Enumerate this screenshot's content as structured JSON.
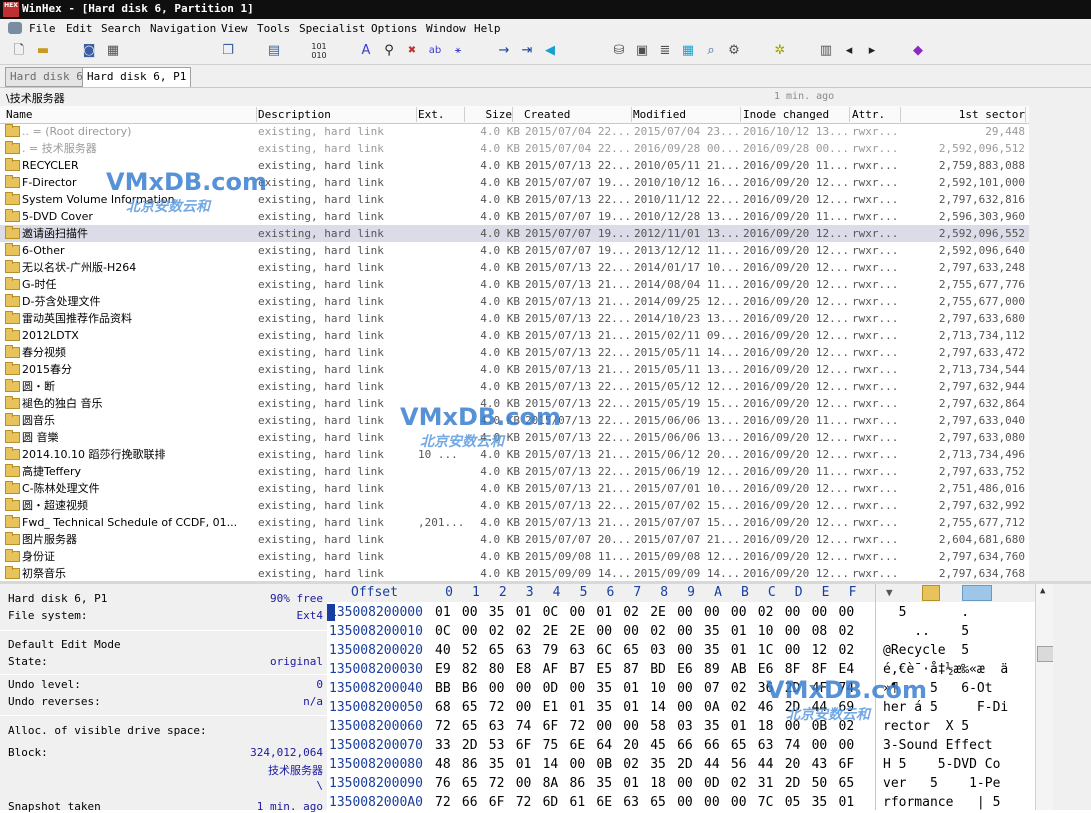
{
  "window": {
    "title": "WinHex - [Hard disk 6, Partition 1]",
    "app_icon_text": "HEX"
  },
  "menu": [
    "File",
    "Edit",
    "Search",
    "Navigation",
    "View",
    "Tools",
    "Specialist",
    "Options",
    "Window",
    "Help"
  ],
  "toolbar": {
    "icons": [
      "new-file-icon",
      "open-file-icon",
      "save-icon",
      "print-icon",
      "copy-icon",
      "paste-icon",
      "hex-edit-icon",
      "find-icon",
      "find-hex-icon",
      "replace-icon",
      "replace-hex-icon",
      "goto-icon",
      "goto-offset-icon",
      "back-icon",
      "disk-icon",
      "drive-icon",
      "ram-icon",
      "calculator-icon",
      "magnify-icon",
      "settings-icon",
      "gear-icon",
      "view-icon",
      "prev-icon",
      "next-icon",
      "case-icon"
    ]
  },
  "tabs": [
    {
      "label": "Hard disk 6",
      "active": false
    },
    {
      "label": "Hard disk 6, P1",
      "active": true
    }
  ],
  "path": {
    "current": "\\技术服务器",
    "updated": "1 min. ago"
  },
  "columns": [
    "Name",
    "Description",
    "Ext.",
    "Size",
    "Created",
    "Modified",
    "Inode changed",
    "Attr.",
    "1st sector"
  ],
  "rows": [
    {
      "name": "..  =  (Root directory)",
      "desc": "existing, hard link",
      "ext": "",
      "size": "4.0 KB",
      "created": "2015/07/04  22...",
      "modified": "2015/07/04  23...",
      "inode": "2016/10/12  13...",
      "attr": "rwxr...",
      "sector": "29,448",
      "dim": true
    },
    {
      "name": ".  =  技术服务器",
      "desc": "existing, hard link",
      "ext": "",
      "size": "4.0 KB",
      "created": "2015/07/04  22...",
      "modified": "2016/09/28  00...",
      "inode": "2016/09/28  00...",
      "attr": "rwxr...",
      "sector": "2,592,096,512",
      "dim": true
    },
    {
      "name": "RECYCLER",
      "desc": "existing, hard link",
      "ext": "",
      "size": "4.0 KB",
      "created": "2015/07/13  22...",
      "modified": "2010/05/11  21...",
      "inode": "2016/09/20  11...",
      "attr": "rwxr...",
      "sector": "2,759,883,088"
    },
    {
      "name": "F-Director",
      "desc": "existing, hard link",
      "ext": "",
      "size": "4.0 KB",
      "created": "2015/07/07  19...",
      "modified": "2010/10/12  16...",
      "inode": "2016/09/20  12...",
      "attr": "rwxr...",
      "sector": "2,592,101,000"
    },
    {
      "name": "System Volume Information",
      "desc": "existing, hard link",
      "ext": "",
      "size": "4.0 KB",
      "created": "2015/07/13  22...",
      "modified": "2010/11/12  22...",
      "inode": "2016/09/20  12...",
      "attr": "rwxr...",
      "sector": "2,797,632,816"
    },
    {
      "name": "5-DVD Cover",
      "desc": "existing, hard link",
      "ext": "",
      "size": "4.0 KB",
      "created": "2015/07/07  19...",
      "modified": "2010/12/28  13...",
      "inode": "2016/09/20  11...",
      "attr": "rwxr...",
      "sector": "2,596,303,960"
    },
    {
      "name": "邀请函扫描件",
      "desc": "existing, hard link",
      "ext": "",
      "size": "4.0 KB",
      "created": "2015/07/07  19...",
      "modified": "2012/11/01  13...",
      "inode": "2016/09/20  12...",
      "attr": "rwxr...",
      "sector": "2,592,096,552",
      "sel": true
    },
    {
      "name": "6-Other",
      "desc": "existing, hard link",
      "ext": "",
      "size": "4.0 KB",
      "created": "2015/07/07  19...",
      "modified": "2013/12/12  11...",
      "inode": "2016/09/20  12...",
      "attr": "rwxr...",
      "sector": "2,592,096,640"
    },
    {
      "name": "无以名状-广州版-H264",
      "desc": "existing, hard link",
      "ext": "",
      "size": "4.0 KB",
      "created": "2015/07/13  22...",
      "modified": "2014/01/17  10...",
      "inode": "2016/09/20  12...",
      "attr": "rwxr...",
      "sector": "2,797,633,248"
    },
    {
      "name": "G-时任",
      "desc": "existing, hard link",
      "ext": "",
      "size": "4.0 KB",
      "created": "2015/07/13  21...",
      "modified": "2014/08/04  11...",
      "inode": "2016/09/20  12...",
      "attr": "rwxr...",
      "sector": "2,755,677,776"
    },
    {
      "name": "D-芬含处理文件",
      "desc": "existing, hard link",
      "ext": "",
      "size": "4.0 KB",
      "created": "2015/07/13  21...",
      "modified": "2014/09/25  12...",
      "inode": "2016/09/20  12...",
      "attr": "rwxr...",
      "sector": "2,755,677,000"
    },
    {
      "name": "雷动英国推荐作品资料",
      "desc": "existing, hard link",
      "ext": "",
      "size": "4.0 KB",
      "created": "2015/07/13  22...",
      "modified": "2014/10/23  13...",
      "inode": "2016/09/20  12...",
      "attr": "rwxr...",
      "sector": "2,797,633,680"
    },
    {
      "name": "2012LDTX",
      "desc": "existing, hard link",
      "ext": "",
      "size": "4.0 KB",
      "created": "2015/07/13  21...",
      "modified": "2015/02/11  09...",
      "inode": "2016/09/20  12...",
      "attr": "rwxr...",
      "sector": "2,713,734,112"
    },
    {
      "name": "春分视频",
      "desc": "existing, hard link",
      "ext": "",
      "size": "4.0 KB",
      "created": "2015/07/13  22...",
      "modified": "2015/05/11  14...",
      "inode": "2016/09/20  12...",
      "attr": "rwxr...",
      "sector": "2,797,633,472"
    },
    {
      "name": "2015春分",
      "desc": "existing, hard link",
      "ext": "",
      "size": "4.0 KB",
      "created": "2015/07/13  21...",
      "modified": "2015/05/11  13...",
      "inode": "2016/09/20  12...",
      "attr": "rwxr...",
      "sector": "2,713,734,544"
    },
    {
      "name": "圆・断",
      "desc": "existing, hard link",
      "ext": "",
      "size": "4.0 KB",
      "created": "2015/07/13  22...",
      "modified": "2015/05/12  12...",
      "inode": "2016/09/20  12...",
      "attr": "rwxr...",
      "sector": "2,797,632,944"
    },
    {
      "name": "  褪色的独白  音乐",
      "desc": "existing, hard link",
      "ext": "",
      "size": "4.0 KB",
      "created": "2015/07/13  22...",
      "modified": "2015/05/19  15...",
      "inode": "2016/09/20  12...",
      "attr": "rwxr...",
      "sector": "2,797,632,864"
    },
    {
      "name": "圆音乐",
      "desc": "existing, hard link",
      "ext": "",
      "size": "4.0 KB",
      "created": "2015/07/13  22...",
      "modified": "2015/06/06  13...",
      "inode": "2016/09/20  11...",
      "attr": "rwxr...",
      "sector": "2,797,633,040"
    },
    {
      "name": "圆 音樂",
      "desc": "existing, hard link",
      "ext": "",
      "size": "4.0 KB",
      "created": "2015/07/13  22...",
      "modified": "2015/06/06  13...",
      "inode": "2016/09/20  12...",
      "attr": "rwxr...",
      "sector": "2,797,633,080"
    },
    {
      "name": "2014.10.10 蹈莎行挽歌联排",
      "desc": "existing, hard link",
      "ext": "10 ...",
      "size": "4.0 KB",
      "created": "2015/07/13  21...",
      "modified": "2015/06/12  20...",
      "inode": "2016/09/20  12...",
      "attr": "rwxr...",
      "sector": "2,713,734,496"
    },
    {
      "name": "高捷Teffery",
      "desc": "existing, hard link",
      "ext": "",
      "size": "4.0 KB",
      "created": "2015/07/13  22...",
      "modified": "2015/06/19  12...",
      "inode": "2016/09/20  11...",
      "attr": "rwxr...",
      "sector": "2,797,633,752"
    },
    {
      "name": "C-陈林处理文件",
      "desc": "existing, hard link",
      "ext": "",
      "size": "4.0 KB",
      "created": "2015/07/13  21...",
      "modified": "2015/07/01  10...",
      "inode": "2016/09/20  12...",
      "attr": "rwxr...",
      "sector": "2,751,486,016"
    },
    {
      "name": "圆・超速视频",
      "desc": "existing, hard link",
      "ext": "",
      "size": "4.0 KB",
      "created": "2015/07/13  22...",
      "modified": "2015/07/02  15...",
      "inode": "2016/09/20  12...",
      "attr": "rwxr...",
      "sector": "2,797,632,992"
    },
    {
      "name": "Fwd_ Technical Schedule of CCDF, 01...",
      "desc": "existing, hard link",
      "ext": ",201...",
      "size": "4.0 KB",
      "created": "2015/07/13  21...",
      "modified": "2015/07/07  15...",
      "inode": "2016/09/20  12...",
      "attr": "rwxr...",
      "sector": "2,755,677,712"
    },
    {
      "name": "图片服务器",
      "desc": "existing, hard link",
      "ext": "",
      "size": "4.0 KB",
      "created": "2015/07/07  20...",
      "modified": "2015/07/07  21...",
      "inode": "2016/09/20  12...",
      "attr": "rwxr...",
      "sector": "2,604,681,680"
    },
    {
      "name": "身份证",
      "desc": "existing, hard link",
      "ext": "",
      "size": "4.0 KB",
      "created": "2015/09/08  11...",
      "modified": "2015/09/08  12...",
      "inode": "2016/09/20  12...",
      "attr": "rwxr...",
      "sector": "2,797,634,760"
    },
    {
      "name": "初祭音乐",
      "desc": "existing, hard link",
      "ext": "",
      "size": "4.0 KB",
      "created": "2015/09/09  14...",
      "modified": "2015/09/09  14...",
      "inode": "2016/09/20  12...",
      "attr": "rwxr...",
      "sector": "2,797,634,768"
    }
  ],
  "info": {
    "device": "Hard disk 6, P1",
    "free": "90% free",
    "fs_label": "File system:",
    "fs": "Ext4",
    "mode_label": "Default Edit Mode",
    "state_label": "State:",
    "state": "original",
    "undo_label": "Undo level:",
    "undo": "0",
    "undo_rev_label": "Undo reverses:",
    "undo_rev": "n/a",
    "alloc_label": "Alloc. of visible drive space:",
    "block_label": "Block:",
    "block": "324,012,064",
    "block_name": "技术服务器",
    "block_path": "\\",
    "snapshot_label": "Snapshot taken",
    "snapshot": "1 min. ago"
  },
  "hex": {
    "offset_label": "Offset",
    "columns": [
      "0",
      "1",
      "2",
      "3",
      "4",
      "5",
      "6",
      "7",
      "8",
      "9",
      "A",
      "B",
      "C",
      "D",
      "E",
      "F"
    ],
    "rows": [
      {
        "addr": "135008200000",
        "bytes": [
          "01",
          "00",
          "35",
          "01",
          "0C",
          "00",
          "01",
          "02",
          "2E",
          "00",
          "00",
          "00",
          "02",
          "00",
          "00",
          "00"
        ],
        "ascii": "  5       ."
      },
      {
        "addr": "135008200010",
        "bytes": [
          "0C",
          "00",
          "02",
          "02",
          "2E",
          "2E",
          "00",
          "00",
          "02",
          "00",
          "35",
          "01",
          "10",
          "00",
          "08",
          "02"
        ],
        "ascii": "    ..    5"
      },
      {
        "addr": "135008200020",
        "bytes": [
          "40",
          "52",
          "65",
          "63",
          "79",
          "63",
          "6C",
          "65",
          "03",
          "00",
          "35",
          "01",
          "1C",
          "00",
          "12",
          "02"
        ],
        "ascii": "@Recycle  5"
      },
      {
        "addr": "135008200030",
        "bytes": [
          "E9",
          "82",
          "80",
          "E8",
          "AF",
          "B7",
          "E5",
          "87",
          "BD",
          "E6",
          "89",
          "AB",
          "E6",
          "8F",
          "8F",
          "E4"
        ],
        "ascii": "é‚€è¯·å‡½æ‰«æ  ä"
      },
      {
        "addr": "135008200040",
        "bytes": [
          "BB",
          "B6",
          "00",
          "00",
          "0D",
          "00",
          "35",
          "01",
          "10",
          "00",
          "07",
          "02",
          "36",
          "2D",
          "4F",
          "74"
        ],
        "ascii": "»¶    5   6-Ot"
      },
      {
        "addr": "135008200050",
        "bytes": [
          "68",
          "65",
          "72",
          "00",
          "E1",
          "01",
          "35",
          "01",
          "14",
          "00",
          "0A",
          "02",
          "46",
          "2D",
          "44",
          "69"
        ],
        "ascii": "her á 5     F-Di"
      },
      {
        "addr": "135008200060",
        "bytes": [
          "72",
          "65",
          "63",
          "74",
          "6F",
          "72",
          "00",
          "00",
          "58",
          "03",
          "35",
          "01",
          "18",
          "00",
          "0B",
          "02"
        ],
        "ascii": "rector  X 5"
      },
      {
        "addr": "135008200070",
        "bytes": [
          "33",
          "2D",
          "53",
          "6F",
          "75",
          "6E",
          "64",
          "20",
          "45",
          "66",
          "66",
          "65",
          "63",
          "74",
          "00",
          "00"
        ],
        "ascii": "3-Sound Effect"
      },
      {
        "addr": "135008200080",
        "bytes": [
          "48",
          "86",
          "35",
          "01",
          "14",
          "00",
          "0B",
          "02",
          "35",
          "2D",
          "44",
          "56",
          "44",
          "20",
          "43",
          "6F"
        ],
        "ascii": "H 5    5-DVD Co"
      },
      {
        "addr": "135008200090",
        "bytes": [
          "76",
          "65",
          "72",
          "00",
          "8A",
          "86",
          "35",
          "01",
          "18",
          "00",
          "0D",
          "02",
          "31",
          "2D",
          "50",
          "65"
        ],
        "ascii": "ver   5    1-Pe"
      },
      {
        "addr": "1350082000A0",
        "bytes": [
          "72",
          "66",
          "6F",
          "72",
          "6D",
          "61",
          "6E",
          "63",
          "65",
          "00",
          "00",
          "00",
          "7C",
          "05",
          "35",
          "01"
        ],
        "ascii": "rformance   | 5"
      }
    ]
  },
  "watermarks": [
    {
      "big": "VMxDB.com",
      "small": "北京安数云和"
    },
    {
      "big": "VMxDB.com",
      "small": "北京安数云和"
    },
    {
      "big": "VMxDB.com",
      "small": "北京安数云和"
    }
  ]
}
